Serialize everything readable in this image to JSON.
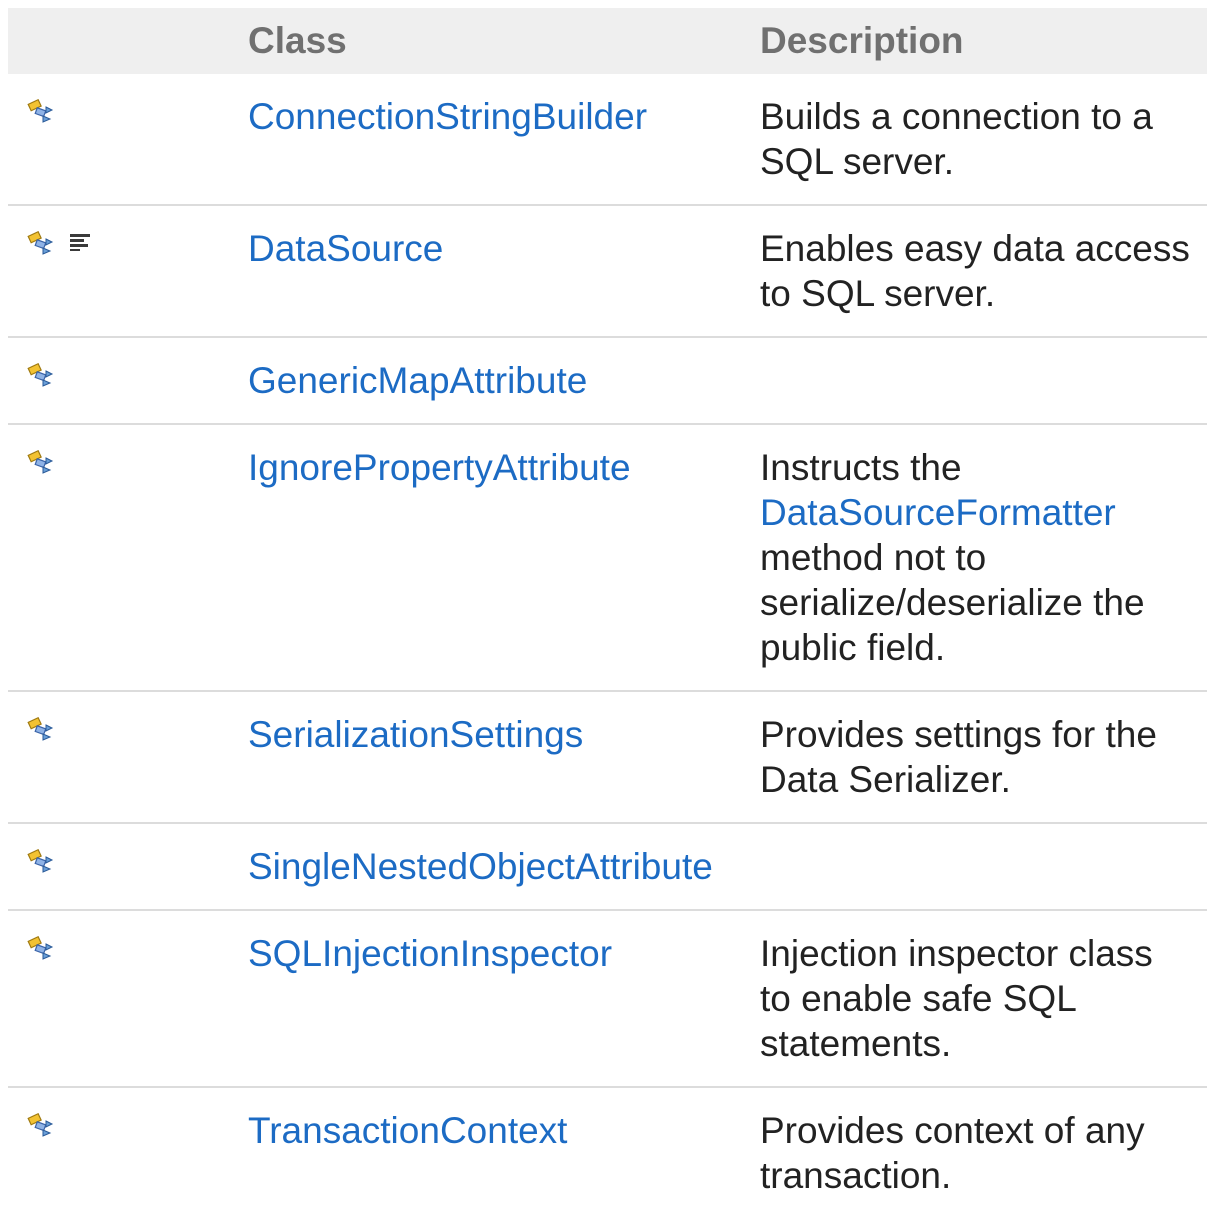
{
  "header": {
    "class_label": "Class",
    "description_label": "Description"
  },
  "rows": [
    {
      "name": "ConnectionStringBuilder",
      "icons": [
        "public-class-icon"
      ],
      "description": "Builds a connection to a SQL server."
    },
    {
      "name": "DataSource",
      "icons": [
        "public-class-icon",
        "static-member-icon"
      ],
      "description": "Enables easy data access to SQL server."
    },
    {
      "name": "GenericMapAttribute",
      "icons": [
        "public-class-icon"
      ],
      "description": ""
    },
    {
      "name": "IgnorePropertyAttribute",
      "icons": [
        "public-class-icon"
      ],
      "description_prefix": "Instructs the",
      "description_link": "DataSourceFormatter",
      "description_suffix": "method not to serialize/deserialize the public field."
    },
    {
      "name": "SerializationSettings",
      "icons": [
        "public-class-icon"
      ],
      "description": "Provides settings for the Data Serializer."
    },
    {
      "name": "SingleNestedObjectAttribute",
      "icons": [
        "public-class-icon"
      ],
      "description": ""
    },
    {
      "name": "SQLInjectionInspector",
      "icons": [
        "public-class-icon"
      ],
      "description": "Injection inspector class to enable safe SQL statements."
    },
    {
      "name": "TransactionContext",
      "icons": [
        "public-class-icon"
      ],
      "description": "Provides context of any transaction."
    }
  ],
  "colors": {
    "link": "#1c6bc4",
    "header_bg": "#efefef",
    "header_text": "#707070",
    "row_divider": "#dcdcdc"
  }
}
